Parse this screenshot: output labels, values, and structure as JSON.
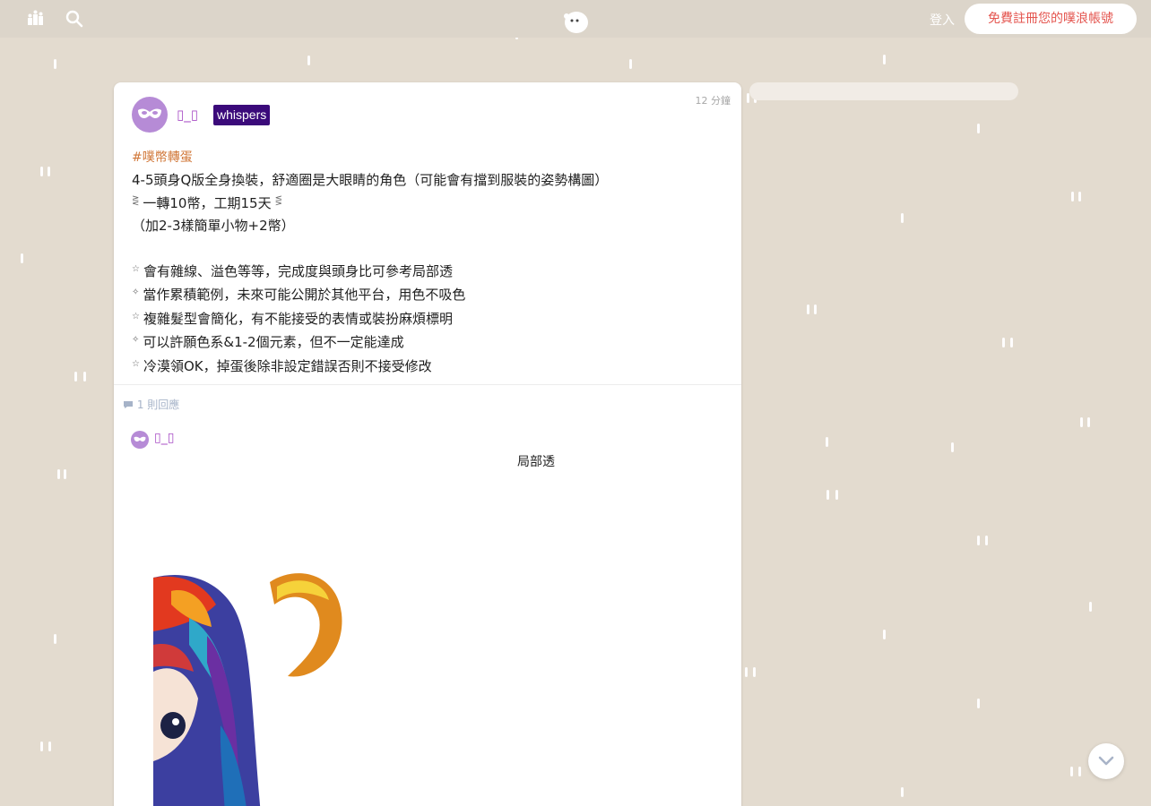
{
  "header": {
    "login_label": "登入",
    "signup_label": "免費註冊您的噗浪帳號"
  },
  "post": {
    "username": "▯_▯",
    "badge": "whispers",
    "time": "12 分鐘",
    "hashtag": "#噗幣轉蛋",
    "lines": [
      "4-5頭身Q版全身換裝，舒適圈是大眼睛的角色（可能會有擋到服裝的姿勢構圖）",
      "一轉10幣，工期15天",
      "（加2-3樣簡單小物+2幣）",
      "會有雜線、溢色等等，完成度與頭身比可參考局部透",
      "當作累積範例，未來可能公開於其他平台，用色不吸色",
      "複雜髮型會簡化，有不能接受的表情或裝扮麻煩標明",
      "可以許願色系&1-2個元素，但不一定能達成",
      "冷漠領OK，掉蛋後除非設定錯誤否則不接受修改"
    ]
  },
  "responses": {
    "count_label": "1 則回應",
    "reply": {
      "username": "▯_▯",
      "text": "局部透"
    }
  },
  "colors": {
    "background": "#e3dbcf",
    "topbar": "#dcd5ca",
    "username": "#a94fc6",
    "badge_bg": "#3b0a7a",
    "hashtag": "#d1783a",
    "signup_text": "#e4554f"
  }
}
